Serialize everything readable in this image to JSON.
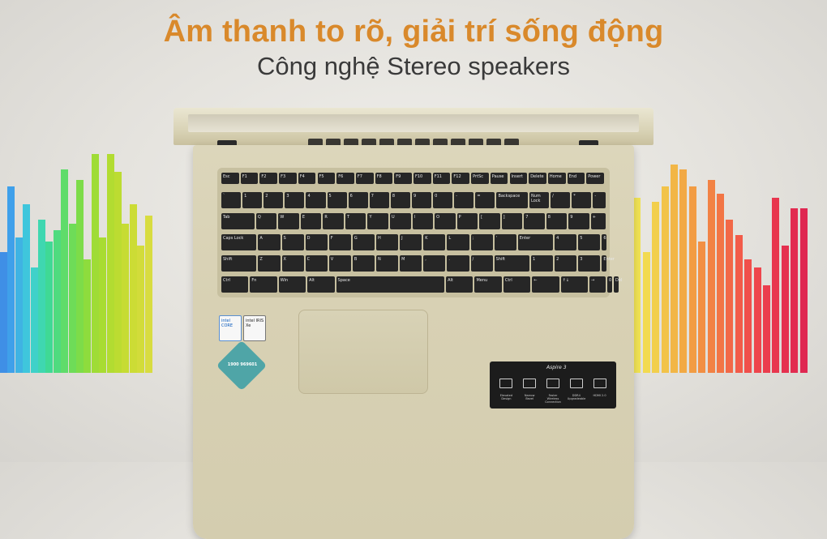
{
  "headline": "Âm thanh to rõ, giải trí sống động",
  "subline": "Công nghệ Stereo speakers",
  "colors": {
    "headline": "#d9892b",
    "subline": "#3a3a3a",
    "laptop_body": "#d8d1b4",
    "keys": "#262626"
  },
  "equalizer": {
    "left_heights_fraction": [
      0.55,
      0.85,
      0.62,
      0.77,
      0.48,
      0.7,
      0.6,
      0.65,
      0.93,
      0.68,
      0.88,
      0.52,
      1.0,
      0.62,
      1.0,
      0.92,
      0.68,
      0.77,
      0.58,
      0.72
    ],
    "right_heights_fraction": [
      0.68,
      0.8,
      0.55,
      0.78,
      0.85,
      0.95,
      0.93,
      0.85,
      0.6,
      0.88,
      0.82,
      0.7,
      0.63,
      0.52,
      0.48,
      0.4,
      0.8,
      0.58,
      0.75,
      0.75
    ],
    "left_colors": [
      "#3f8fe6",
      "#3fa0ea",
      "#3fb3e3",
      "#3fc6dc",
      "#3fd1c9",
      "#3fd7b0",
      "#3fd995",
      "#4fdb7f",
      "#5fdc6a",
      "#6edc58",
      "#7ddc49",
      "#8edc3d",
      "#9fdc36",
      "#a8dc32",
      "#b2dc31",
      "#bcdc31",
      "#c6dc33",
      "#ccdc35",
      "#d2dc3a",
      "#d8dc40"
    ],
    "right_colors": [
      "#f2ee58",
      "#f2e454",
      "#f2da50",
      "#f2cf4c",
      "#f2c349",
      "#f2b646",
      "#f2a944",
      "#f29c43",
      "#f28f43",
      "#f28244",
      "#f27545",
      "#f26847",
      "#f25b49",
      "#f04f4b",
      "#ee454c",
      "#eb3d4d",
      "#e8364e",
      "#e5304f",
      "#e22b50",
      "#df2751"
    ]
  },
  "stickers": {
    "intel_core": "intel CORE",
    "intel_iris": "intel IRIS Xe",
    "warranty_phone": "1900 969601"
  },
  "feature_plate": {
    "model": "Aspire 3",
    "icons": [
      "elevated-design-icon",
      "narrow-bezel-icon",
      "wifi-6-icon",
      "ddr4-icon",
      "hdmi-icon"
    ],
    "captions": [
      "Elevated Design",
      "Narrow Bezel",
      "Faster Wireless Connection",
      "DDR4 Upgradeable",
      "HDMI 2.0"
    ]
  },
  "keyboard_rows": [
    [
      "Esc",
      "F1",
      "F2",
      "F3",
      "F4",
      "F5",
      "F6",
      "F7",
      "F8",
      "F9",
      "F10",
      "F11",
      "F12",
      "PrtSc",
      "Pause",
      "Insert",
      "Delete",
      "Home",
      "End",
      "Power"
    ],
    [
      "`",
      "1",
      "2",
      "3",
      "4",
      "5",
      "6",
      "7",
      "8",
      "9",
      "0",
      "-",
      "=",
      "Backspace",
      "Num Lock",
      "/",
      "*",
      "-"
    ],
    [
      "Tab",
      "Q",
      "W",
      "E",
      "R",
      "T",
      "Y",
      "U",
      "I",
      "O",
      "P",
      "[",
      "]",
      "7",
      "8",
      "9",
      "+"
    ],
    [
      "Caps Lock",
      "A",
      "S",
      "D",
      "F",
      "G",
      "H",
      "J",
      "K",
      "L",
      ";",
      "'",
      "Enter",
      "4",
      "5",
      "6"
    ],
    [
      "Shift",
      "Z",
      "X",
      "C",
      "V",
      "B",
      "N",
      "M",
      ",",
      ".",
      "/",
      "Shift",
      "1",
      "2",
      "3",
      "Enter"
    ],
    [
      "Ctrl",
      "Fn",
      "Win",
      "Alt",
      "Space",
      "Alt",
      "Menu",
      "Ctrl",
      "←",
      "↑↓",
      "→",
      "0",
      "Del"
    ]
  ]
}
